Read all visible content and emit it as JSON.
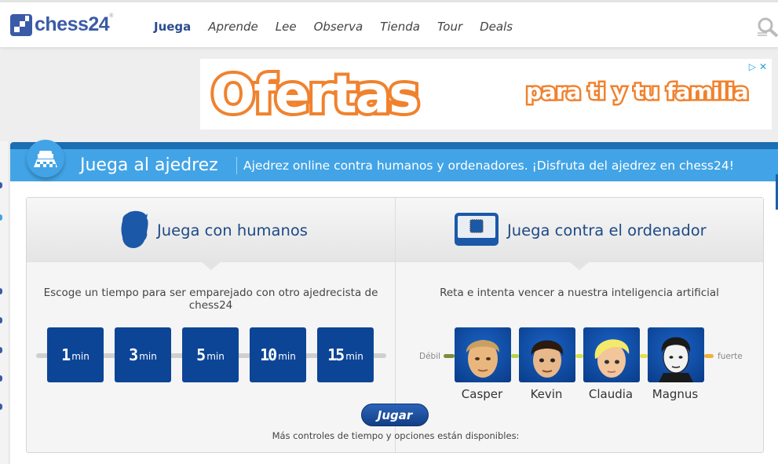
{
  "brand": {
    "name": "chess24",
    "trademark": "®",
    "color": "#3a5ba6"
  },
  "nav": {
    "items": [
      {
        "label": "Juega",
        "active": true
      },
      {
        "label": "Aprende"
      },
      {
        "label": "Lee"
      },
      {
        "label": "Observa"
      },
      {
        "label": "Tienda"
      },
      {
        "label": "Tour"
      },
      {
        "label": "Deals"
      }
    ],
    "search_icon": "search-icon"
  },
  "ad": {
    "headline": "Ofertas",
    "tagline": "para ti y tu familia",
    "adchoices_icon": "adchoices-icon",
    "close_icon": "close-icon"
  },
  "banner": {
    "icon": "chessboard-icon",
    "title": "Juega al ajedrez",
    "subtitle": "Ajedrez online contra humanos y ordenadores. ¡Disfruta del ajedrez en chess24!"
  },
  "humans": {
    "icon": "human-head-icon",
    "title": "Juega con humanos",
    "description": "Escoge un tiempo para ser emparejado con otro ajedrecista de chess24",
    "time_controls": [
      {
        "value": "1",
        "unit": "min"
      },
      {
        "value": "3",
        "unit": "min"
      },
      {
        "value": "5",
        "unit": "min"
      },
      {
        "value": "10",
        "unit": "min"
      },
      {
        "value": "15",
        "unit": "min"
      }
    ]
  },
  "computer": {
    "icon": "computer-chip-icon",
    "title": "Juega contra el ordenador",
    "description": "Reta e intenta vencer a nuestra inteligencia artificial",
    "weak_label": "Débil",
    "strong_label": "fuerte",
    "bots": [
      {
        "name": "Casper"
      },
      {
        "name": "Kevin"
      },
      {
        "name": "Claudia"
      },
      {
        "name": "Magnus"
      }
    ],
    "level_colors": [
      "#7a8f3a",
      "#b9d34a",
      "#e3e04a",
      "#f2b03c"
    ]
  },
  "play_button": "Jugar",
  "more_options": "Más controles de tiempo y opciones están disponibles:"
}
